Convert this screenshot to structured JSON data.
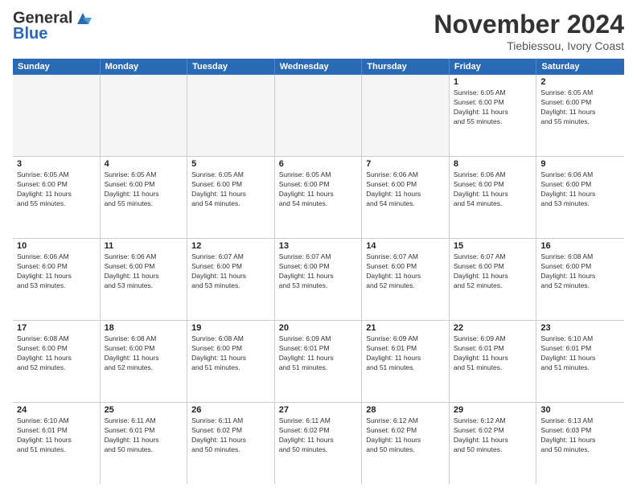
{
  "header": {
    "logo_line1": "General",
    "logo_line2": "Blue",
    "month": "November 2024",
    "location": "Tiebiessou, Ivory Coast"
  },
  "days_of_week": [
    "Sunday",
    "Monday",
    "Tuesday",
    "Wednesday",
    "Thursday",
    "Friday",
    "Saturday"
  ],
  "weeks": [
    [
      {
        "day": "",
        "detail": "",
        "empty": true
      },
      {
        "day": "",
        "detail": "",
        "empty": true
      },
      {
        "day": "",
        "detail": "",
        "empty": true
      },
      {
        "day": "",
        "detail": "",
        "empty": true
      },
      {
        "day": "",
        "detail": "",
        "empty": true
      },
      {
        "day": "1",
        "detail": "Sunrise: 6:05 AM\nSunset: 6:00 PM\nDaylight: 11 hours\nand 55 minutes.",
        "empty": false
      },
      {
        "day": "2",
        "detail": "Sunrise: 6:05 AM\nSunset: 6:00 PM\nDaylight: 11 hours\nand 55 minutes.",
        "empty": false
      }
    ],
    [
      {
        "day": "3",
        "detail": "Sunrise: 6:05 AM\nSunset: 6:00 PM\nDaylight: 11 hours\nand 55 minutes.",
        "empty": false
      },
      {
        "day": "4",
        "detail": "Sunrise: 6:05 AM\nSunset: 6:00 PM\nDaylight: 11 hours\nand 55 minutes.",
        "empty": false
      },
      {
        "day": "5",
        "detail": "Sunrise: 6:05 AM\nSunset: 6:00 PM\nDaylight: 11 hours\nand 54 minutes.",
        "empty": false
      },
      {
        "day": "6",
        "detail": "Sunrise: 6:05 AM\nSunset: 6:00 PM\nDaylight: 11 hours\nand 54 minutes.",
        "empty": false
      },
      {
        "day": "7",
        "detail": "Sunrise: 6:06 AM\nSunset: 6:00 PM\nDaylight: 11 hours\nand 54 minutes.",
        "empty": false
      },
      {
        "day": "8",
        "detail": "Sunrise: 6:06 AM\nSunset: 6:00 PM\nDaylight: 11 hours\nand 54 minutes.",
        "empty": false
      },
      {
        "day": "9",
        "detail": "Sunrise: 6:06 AM\nSunset: 6:00 PM\nDaylight: 11 hours\nand 53 minutes.",
        "empty": false
      }
    ],
    [
      {
        "day": "10",
        "detail": "Sunrise: 6:06 AM\nSunset: 6:00 PM\nDaylight: 11 hours\nand 53 minutes.",
        "empty": false
      },
      {
        "day": "11",
        "detail": "Sunrise: 6:06 AM\nSunset: 6:00 PM\nDaylight: 11 hours\nand 53 minutes.",
        "empty": false
      },
      {
        "day": "12",
        "detail": "Sunrise: 6:07 AM\nSunset: 6:00 PM\nDaylight: 11 hours\nand 53 minutes.",
        "empty": false
      },
      {
        "day": "13",
        "detail": "Sunrise: 6:07 AM\nSunset: 6:00 PM\nDaylight: 11 hours\nand 53 minutes.",
        "empty": false
      },
      {
        "day": "14",
        "detail": "Sunrise: 6:07 AM\nSunset: 6:00 PM\nDaylight: 11 hours\nand 52 minutes.",
        "empty": false
      },
      {
        "day": "15",
        "detail": "Sunrise: 6:07 AM\nSunset: 6:00 PM\nDaylight: 11 hours\nand 52 minutes.",
        "empty": false
      },
      {
        "day": "16",
        "detail": "Sunrise: 6:08 AM\nSunset: 6:00 PM\nDaylight: 11 hours\nand 52 minutes.",
        "empty": false
      }
    ],
    [
      {
        "day": "17",
        "detail": "Sunrise: 6:08 AM\nSunset: 6:00 PM\nDaylight: 11 hours\nand 52 minutes.",
        "empty": false
      },
      {
        "day": "18",
        "detail": "Sunrise: 6:08 AM\nSunset: 6:00 PM\nDaylight: 11 hours\nand 52 minutes.",
        "empty": false
      },
      {
        "day": "19",
        "detail": "Sunrise: 6:08 AM\nSunset: 6:00 PM\nDaylight: 11 hours\nand 51 minutes.",
        "empty": false
      },
      {
        "day": "20",
        "detail": "Sunrise: 6:09 AM\nSunset: 6:01 PM\nDaylight: 11 hours\nand 51 minutes.",
        "empty": false
      },
      {
        "day": "21",
        "detail": "Sunrise: 6:09 AM\nSunset: 6:01 PM\nDaylight: 11 hours\nand 51 minutes.",
        "empty": false
      },
      {
        "day": "22",
        "detail": "Sunrise: 6:09 AM\nSunset: 6:01 PM\nDaylight: 11 hours\nand 51 minutes.",
        "empty": false
      },
      {
        "day": "23",
        "detail": "Sunrise: 6:10 AM\nSunset: 6:01 PM\nDaylight: 11 hours\nand 51 minutes.",
        "empty": false
      }
    ],
    [
      {
        "day": "24",
        "detail": "Sunrise: 6:10 AM\nSunset: 6:01 PM\nDaylight: 11 hours\nand 51 minutes.",
        "empty": false
      },
      {
        "day": "25",
        "detail": "Sunrise: 6:11 AM\nSunset: 6:01 PM\nDaylight: 11 hours\nand 50 minutes.",
        "empty": false
      },
      {
        "day": "26",
        "detail": "Sunrise: 6:11 AM\nSunset: 6:02 PM\nDaylight: 11 hours\nand 50 minutes.",
        "empty": false
      },
      {
        "day": "27",
        "detail": "Sunrise: 6:11 AM\nSunset: 6:02 PM\nDaylight: 11 hours\nand 50 minutes.",
        "empty": false
      },
      {
        "day": "28",
        "detail": "Sunrise: 6:12 AM\nSunset: 6:02 PM\nDaylight: 11 hours\nand 50 minutes.",
        "empty": false
      },
      {
        "day": "29",
        "detail": "Sunrise: 6:12 AM\nSunset: 6:02 PM\nDaylight: 11 hours\nand 50 minutes.",
        "empty": false
      },
      {
        "day": "30",
        "detail": "Sunrise: 6:13 AM\nSunset: 6:03 PM\nDaylight: 11 hours\nand 50 minutes.",
        "empty": false
      }
    ]
  ]
}
